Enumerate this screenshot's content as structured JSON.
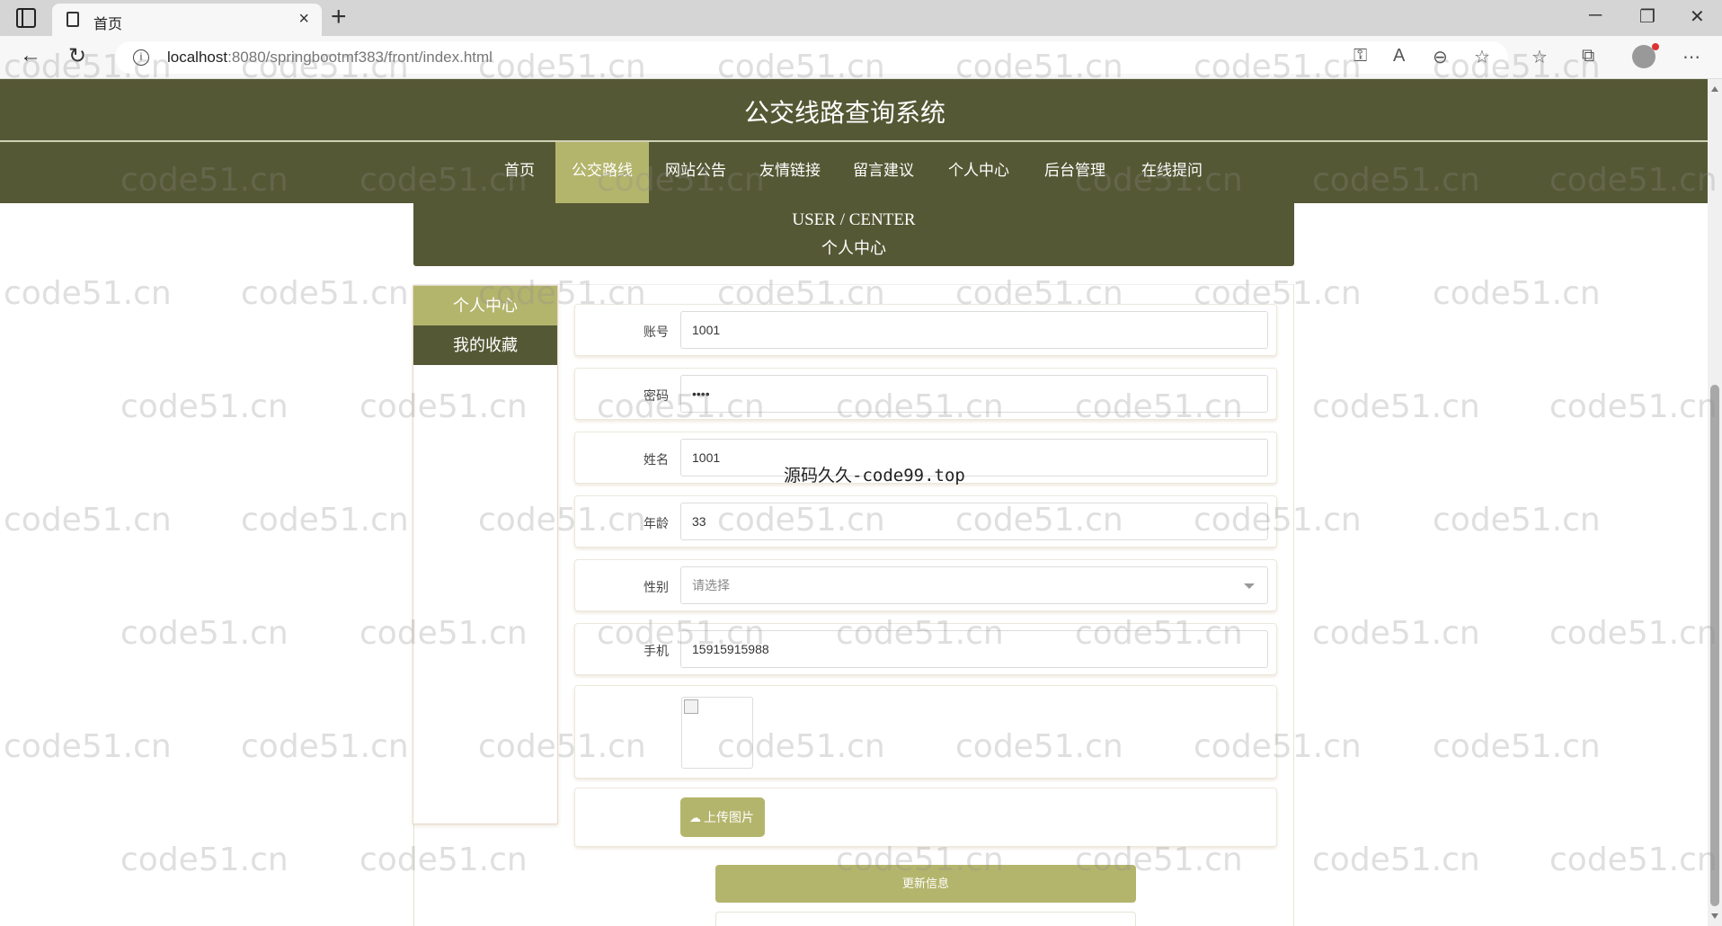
{
  "browser": {
    "tab_title": "首页",
    "tab_close": "×",
    "new_tab": "+",
    "url_host": "localhost",
    "url_rest": ":8080/springbootmf383/front/index.html",
    "window_controls": [
      "─",
      "❐",
      "✕"
    ]
  },
  "site": {
    "title": "公交线路查询系统",
    "nav": [
      "首页",
      "公交路线",
      "网站公告",
      "友情链接",
      "留言建议",
      "个人中心",
      "后台管理",
      "在线提问"
    ],
    "active_nav": "公交路线"
  },
  "banner": {
    "en": "USER / CENTER",
    "cn": "个人中心"
  },
  "side_menu": {
    "items": [
      "个人中心",
      "我的收藏"
    ]
  },
  "form": {
    "account_label": "账号",
    "account_value": "1001",
    "password_label": "密码",
    "password_value": "••••",
    "name_label": "姓名",
    "name_value": "1001",
    "age_label": "年龄",
    "age_value": "33",
    "gender_label": "性别",
    "gender_placeholder": "请选择",
    "phone_label": "手机",
    "phone_value": "15915915988",
    "upload_label": "上传图片",
    "submit_label": "更新信息"
  },
  "watermarks": {
    "text": "code51.cn",
    "center_text": "源码久久-code99.top"
  },
  "colors": {
    "header_bg": "#555834",
    "accent": "#b4b56c"
  }
}
